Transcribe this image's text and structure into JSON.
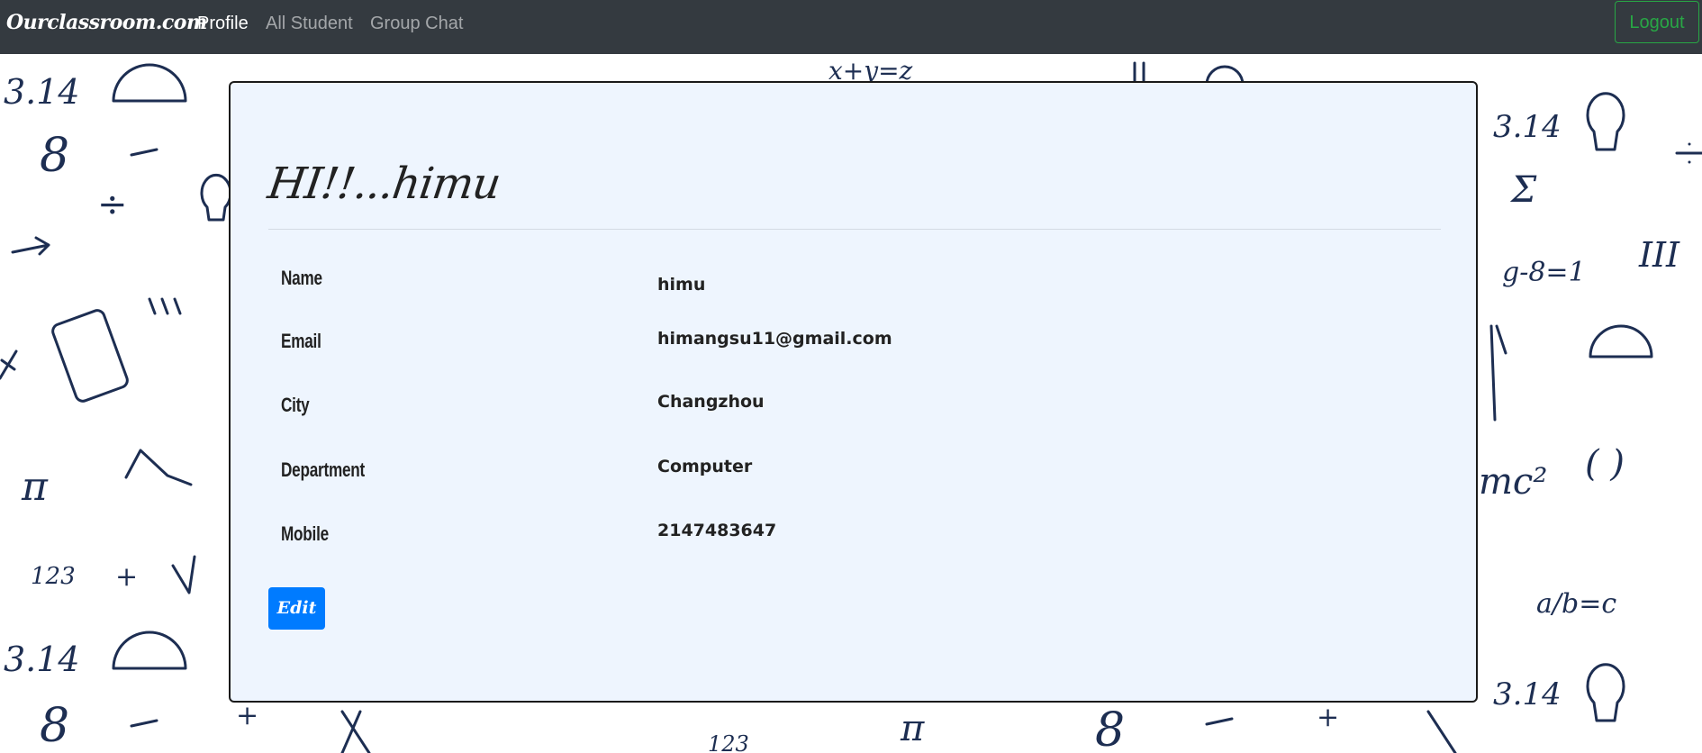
{
  "navbar": {
    "brand": "Ourclassroom.com",
    "links": [
      {
        "label": "Profile",
        "active": true
      },
      {
        "label": "All Student",
        "active": false
      },
      {
        "label": "Group Chat",
        "active": false
      }
    ],
    "logout_label": "Logout"
  },
  "profile": {
    "greeting": "HI!!...himu",
    "fields": [
      {
        "label": "Name",
        "value": "himu"
      },
      {
        "label": "Email",
        "value": "himangsu11@gmail.com"
      },
      {
        "label": "City",
        "value": "Changzhou"
      },
      {
        "label": "Department",
        "value": "Computer"
      },
      {
        "label": "Mobile",
        "value": "2147483647"
      }
    ],
    "edit_label": "Edit"
  },
  "background": {
    "doodles": [
      "3.14",
      "8",
      "÷",
      "π",
      "123",
      "+",
      "x+y=z",
      "Σ",
      "g-8=1",
      "mc²",
      "( )",
      "a/b=c",
      "III"
    ]
  },
  "colors": {
    "navbar_bg": "#343a40",
    "logout_accent": "#28a745",
    "edit_button": "#007bff",
    "card_bg": "#eef5fe",
    "doodle_ink": "#1d2e52"
  }
}
